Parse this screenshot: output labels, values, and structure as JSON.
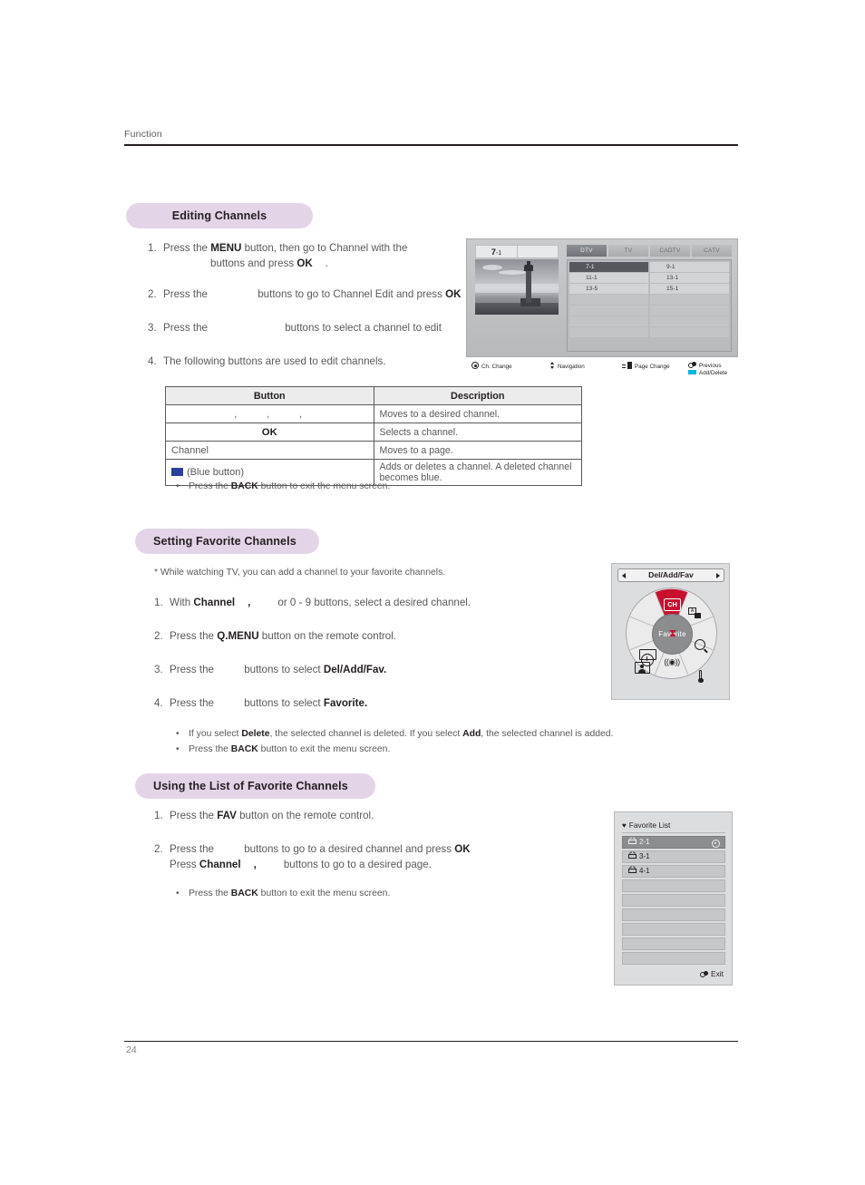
{
  "header": {
    "running_head": "Function"
  },
  "sections": {
    "editing": {
      "pill_label": "Editing Channels",
      "steps": [
        {
          "num": "1.",
          "p1": "Press the ",
          "b1": "MENU",
          "p2": " button, then go to Channel with the",
          "line2_pre": "buttons and press ",
          "b2": "OK",
          "line2_post": "."
        },
        {
          "num": "2.",
          "p1": "Press the ",
          "p2": "buttons to go to Channel Edit and press ",
          "b1": "OK"
        },
        {
          "num": "3.",
          "p1": "Press the ",
          "p2": "buttons to select a channel to edit"
        },
        {
          "num": "4.",
          "p1": "The following buttons are used to edit channels."
        }
      ],
      "table": {
        "headers": [
          "Button",
          "Description"
        ],
        "rows": [
          {
            "button": ", , ,",
            "button_kind": "arrows",
            "description": "Moves to a desired channel."
          },
          {
            "button": "OK",
            "button_kind": "ok",
            "description": "Selects a channel."
          },
          {
            "button": "Channel",
            "button_kind": "text",
            "description": "Moves to a page."
          },
          {
            "button": "(Blue button)",
            "button_kind": "blue",
            "description": "Adds or deletes a channel. A deleted channel becomes blue."
          }
        ]
      },
      "bullet": {
        "pre": "Press the ",
        "b": "BACK",
        "post": " button to exit the menu screen."
      }
    },
    "setting_favorite": {
      "pill_label": "Setting Favorite Channels",
      "note": "* While watching TV, you can add a channel to your favorite channels.",
      "steps": [
        {
          "num": "1.",
          "p1": "With ",
          "b1": "Channel",
          "p2": ",",
          "p3": "or 0 - 9 buttons, select a desired channel."
        },
        {
          "num": "2.",
          "p1": "Press the ",
          "b1": "Q.MENU",
          "p2": " button on the remote control."
        },
        {
          "num": "3.",
          "p1": "Press the ",
          "p2": "buttons to select ",
          "b1": "Del/Add/Fav."
        },
        {
          "num": "4.",
          "p1": "Press the ",
          "p2": "buttons to select ",
          "b1": "Favorite."
        }
      ],
      "bullets": [
        {
          "pre": "If you select ",
          "b1": "Delete",
          "mid": ", the selected channel is deleted. If you select ",
          "b2": "Add",
          "post": ", the selected channel is added."
        },
        {
          "pre": "Press the ",
          "b1": "BACK",
          "post": " button to exit the menu screen."
        }
      ]
    },
    "using_favorite": {
      "pill_label": "Using the List of Favorite Channels",
      "steps": [
        {
          "num": "1.",
          "p1": "Press the ",
          "b1": "FAV",
          "p2": " button on the remote control."
        },
        {
          "num": "2.",
          "p1": "Press the ",
          "p2": "buttons to go to a desired channel and press ",
          "b1": "OK",
          "line2_pre": "Press ",
          "line2_b": "Channel",
          "line2_mid": ",",
          "line2_post": "buttons to go to a desired page."
        }
      ],
      "bullet": {
        "pre": "Press the ",
        "b": "BACK",
        "post": " button to exit the menu screen."
      }
    }
  },
  "figures": {
    "tv_screen": {
      "preview_channel_major": "7",
      "preview_channel_sep": "-",
      "preview_channel_minor": "1",
      "tabs": [
        {
          "label": "DTV",
          "active": true
        },
        {
          "label": "TV",
          "active": false
        },
        {
          "label": "CADTV",
          "active": false
        },
        {
          "label": "CATV",
          "active": false
        }
      ],
      "channel_rows": [
        {
          "left": "7-1",
          "right": "9-1",
          "left_selected": true
        },
        {
          "left": "11-1",
          "right": "13-1",
          "left_selected": false
        },
        {
          "left": "13-5",
          "right": "15-1",
          "left_selected": false
        },
        {
          "left": "",
          "right": "",
          "left_selected": false
        },
        {
          "left": "",
          "right": "",
          "left_selected": false
        },
        {
          "left": "",
          "right": "",
          "left_selected": false
        },
        {
          "left": "",
          "right": "",
          "left_selected": false
        }
      ],
      "legend": [
        {
          "icon": "wheel-press-icon",
          "label": "Ch. Change"
        },
        {
          "icon": "navigation-icon",
          "label": "Navigation"
        },
        {
          "icon": "page-change-icon",
          "label": "Page Change"
        },
        {
          "icon": "previous-icon",
          "label": "Previous"
        },
        {
          "icon": "blue-button-icon",
          "label": "Add/Delete"
        }
      ]
    },
    "remote_wheel": {
      "topbar_label": "Del/Add/Fav",
      "hub_label": "Favorite",
      "highlight_color": "#c8102e",
      "segments": [
        {
          "name": "ch-icon",
          "label": "CH",
          "highlighted": true
        },
        {
          "name": "pip-icon",
          "label": ""
        },
        {
          "name": "magnifier-icon",
          "label": ""
        },
        {
          "name": "thermometer-icon",
          "label": ""
        },
        {
          "name": "sound-icon",
          "label": "((◉))"
        },
        {
          "name": "aspect-ratio-icon",
          "label": ""
        },
        {
          "name": "picture-mode-icon",
          "label": ""
        },
        {
          "name": "sleep-timer-icon",
          "label": ""
        }
      ]
    },
    "favorite_list": {
      "title": "Favorite List",
      "heart": "♥",
      "rows": [
        {
          "label": "2-1",
          "selected": true,
          "marker": true
        },
        {
          "label": "3-1",
          "selected": false,
          "marker": false
        },
        {
          "label": "4-1",
          "selected": false,
          "marker": false
        },
        {
          "label": "",
          "selected": false,
          "marker": false
        },
        {
          "label": "",
          "selected": false,
          "marker": false
        },
        {
          "label": "",
          "selected": false,
          "marker": false
        },
        {
          "label": "",
          "selected": false,
          "marker": false
        },
        {
          "label": "",
          "selected": false,
          "marker": false
        },
        {
          "label": "",
          "selected": false,
          "marker": false
        }
      ],
      "exit_label": "Exit"
    }
  },
  "footer": {
    "page_number": "24"
  }
}
